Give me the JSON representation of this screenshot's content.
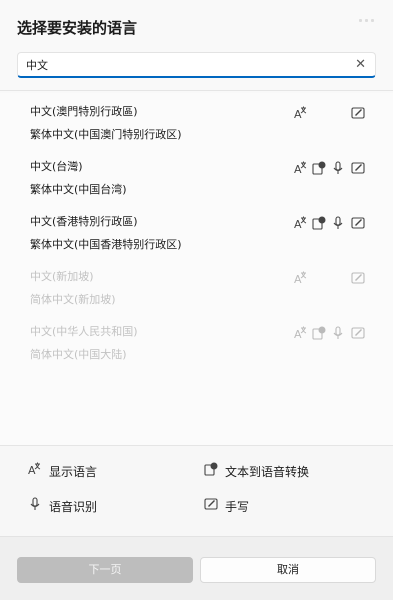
{
  "dialog": {
    "title": "选择要安装的语言"
  },
  "search": {
    "value": "中文",
    "clear_icon": "close-icon"
  },
  "languages": [
    {
      "name": "中文(澳門特別行政區)",
      "native": "繁体中文(中国澳门特别行政区)",
      "enabled": true,
      "features": [
        "display-language"
      ]
    },
    {
      "name": "中文(台灣)",
      "native": "繁体中文(中国台湾)",
      "enabled": true,
      "features": [
        "display-language",
        "text-to-speech",
        "speech-recognition",
        "handwriting"
      ]
    },
    {
      "name": "中文(香港特別行政區)",
      "native": "繁体中文(中国香港特别行政区)",
      "enabled": true,
      "features": [
        "display-language",
        "text-to-speech",
        "speech-recognition",
        "handwriting"
      ]
    },
    {
      "name": "中文(新加坡)",
      "native": "简体中文(新加坡)",
      "enabled": false,
      "features": [
        "display-language",
        "handwriting"
      ]
    },
    {
      "name": "中文(中华人民共和国)",
      "native": "简体中文(中国大陆)",
      "enabled": false,
      "features": [
        "display-language",
        "text-to-speech",
        "speech-recognition",
        "handwriting"
      ]
    }
  ],
  "legend": {
    "display_language": "显示语言",
    "text_to_speech": "文本到语音转换",
    "speech_recognition": "语音识别",
    "handwriting": "手写"
  },
  "buttons": {
    "next": "下一页",
    "cancel": "取消"
  }
}
